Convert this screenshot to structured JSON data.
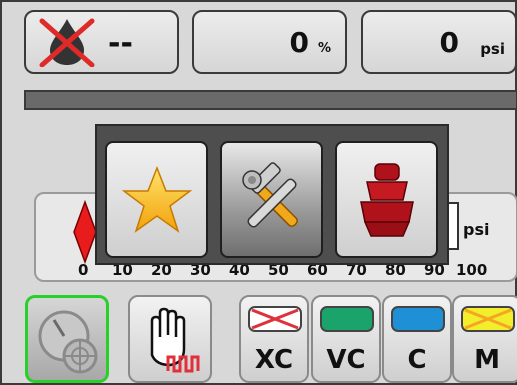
{
  "status": {
    "coverage": {
      "value": "--",
      "icon": "no-coverage-icon"
    },
    "percent": {
      "value": "0",
      "unit": "%"
    },
    "pressure": {
      "value": "0",
      "unit": "psi"
    }
  },
  "progress": {
    "fraction": 0.0
  },
  "gauge": {
    "unit": "psi",
    "ticks": [
      "0",
      "10",
      "20",
      "30",
      "40",
      "50",
      "60",
      "70",
      "80",
      "90",
      "100"
    ],
    "value": 0
  },
  "popup": {
    "items": [
      {
        "icon": "star-icon"
      },
      {
        "icon": "tools-icon"
      },
      {
        "icon": "nozzle-icon"
      }
    ]
  },
  "bottom": {
    "gauge_icon": "gauge-icon",
    "hand_icon": "hand-icon",
    "sections": [
      {
        "label": "XC",
        "color": "#ffffff",
        "crossed": true,
        "cross_color": "#e0303a"
      },
      {
        "label": "VC",
        "color": "#1aa36a",
        "crossed": false
      },
      {
        "label": "C",
        "color": "#1f8fd6",
        "crossed": false
      },
      {
        "label": "M",
        "color": "#f2ee2c",
        "crossed": true,
        "cross_color": "#f5a623"
      }
    ]
  },
  "colors": {
    "accent": "#29d02a",
    "alert": "#e0303a"
  }
}
